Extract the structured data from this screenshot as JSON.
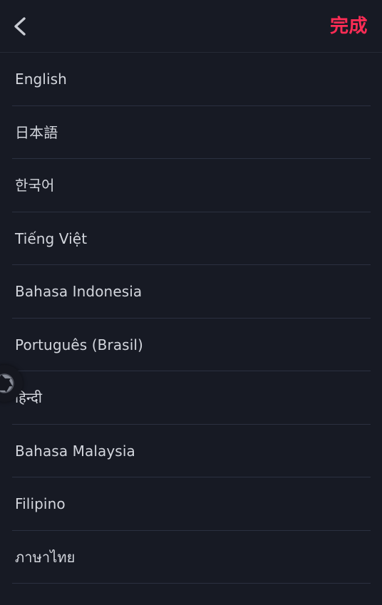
{
  "header": {
    "back_icon": "chevron-left-icon",
    "back_label": "",
    "done_label": "完成",
    "accent_color": "#fe2c55",
    "icon_color": "#c9ccd3"
  },
  "theme": {
    "background": "#171a24",
    "row_background": "#171a24",
    "divider": "#2b3040",
    "text_color": "#d3d6dd"
  },
  "language_list": {
    "items": [
      {
        "label": "English"
      },
      {
        "label": "日本語"
      },
      {
        "label": "한국어"
      },
      {
        "label": "Tiếng Việt"
      },
      {
        "label": "Bahasa Indonesia"
      },
      {
        "label": "Português (Brasil)"
      },
      {
        "label": "हिन्दी"
      },
      {
        "label": "Bahasa Malaysia"
      },
      {
        "label": "Filipino"
      },
      {
        "label": "ภาษาไทย"
      }
    ]
  },
  "floating_widget": {
    "icon": "camera-aperture-icon",
    "color": "#9ba0ab"
  }
}
